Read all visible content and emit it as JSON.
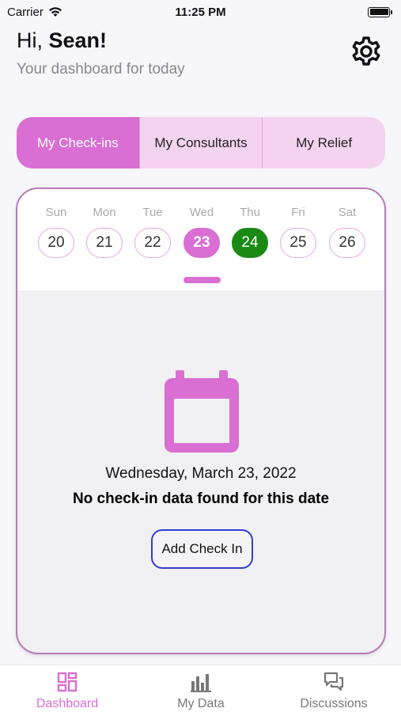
{
  "status_bar": {
    "carrier": "Carrier",
    "time": "11:25 PM"
  },
  "header": {
    "greeting_prefix": "Hi,",
    "user_name": "Sean!",
    "subtitle": "Your dashboard for today"
  },
  "tabs": [
    {
      "label": "My Check-ins",
      "active": true
    },
    {
      "label": "My Consultants",
      "active": false
    },
    {
      "label": "My Relief",
      "active": false
    }
  ],
  "week": [
    {
      "day": "Sun",
      "date": "20",
      "state": "normal"
    },
    {
      "day": "Mon",
      "date": "21",
      "state": "normal"
    },
    {
      "day": "Tue",
      "date": "22",
      "state": "normal"
    },
    {
      "day": "Wed",
      "date": "23",
      "state": "selected"
    },
    {
      "day": "Thu",
      "date": "24",
      "state": "today"
    },
    {
      "day": "Fri",
      "date": "25",
      "state": "normal"
    },
    {
      "day": "Sat",
      "date": "26",
      "state": "normal"
    }
  ],
  "content": {
    "selected_date": "Wednesday, March 23, 2022",
    "empty_message": "No check-in data found for this date",
    "add_button": "Add Check In"
  },
  "bottom_nav": [
    {
      "label": "Dashboard",
      "icon": "dashboard-icon",
      "active": true
    },
    {
      "label": "My Data",
      "icon": "bar-chart-icon",
      "active": false
    },
    {
      "label": "Discussions",
      "icon": "chat-bubbles-icon",
      "active": false
    }
  ],
  "colors": {
    "accent": "#d96ed3",
    "tab_bg": "#f4d3ef",
    "today": "#1a8a14",
    "button_border": "#2f3ecf"
  }
}
